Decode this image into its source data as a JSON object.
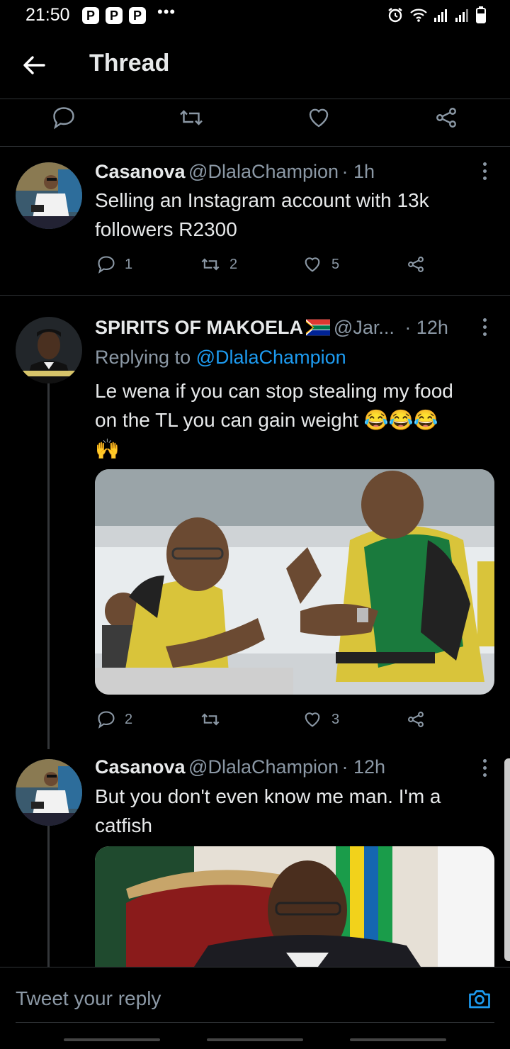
{
  "status_bar": {
    "time": "21:50",
    "badges": [
      "P",
      "P",
      "P"
    ],
    "more": "•••"
  },
  "header": {
    "title": "Thread"
  },
  "tweets": [
    {
      "name": "Casanova",
      "handle": "@DlalaChampion",
      "time": "· 1h",
      "text_lines": [
        "Selling an Instagram account with 13k",
        "followers R2300"
      ],
      "replies": "1",
      "retweets": "2",
      "likes": "5"
    },
    {
      "name": "SPIRITS OF MAKOELA",
      "handle": "@Jar...",
      "time": "· 12h",
      "replying_prefix": "Replying to",
      "replying_to": "@DlalaChampion",
      "text_lines": [
        "Le wena if you can stop stealing my food",
        "on the TL you can gain weight  😂😂😂",
        "🙌"
      ],
      "replies": "2",
      "retweets": "",
      "likes": "3"
    },
    {
      "name": "Casanova",
      "handle": "@DlalaChampion",
      "time": "· 12h",
      "text_lines": [
        "But you don't even know me man. I'm a",
        "catfish"
      ]
    }
  ],
  "reply_bar": {
    "placeholder": "Tweet your reply"
  },
  "colors": {
    "background": "#000000",
    "text": "#e7e9ea",
    "muted": "#8b98a5",
    "accent": "#1d9bf0",
    "divider": "#2f3336"
  }
}
